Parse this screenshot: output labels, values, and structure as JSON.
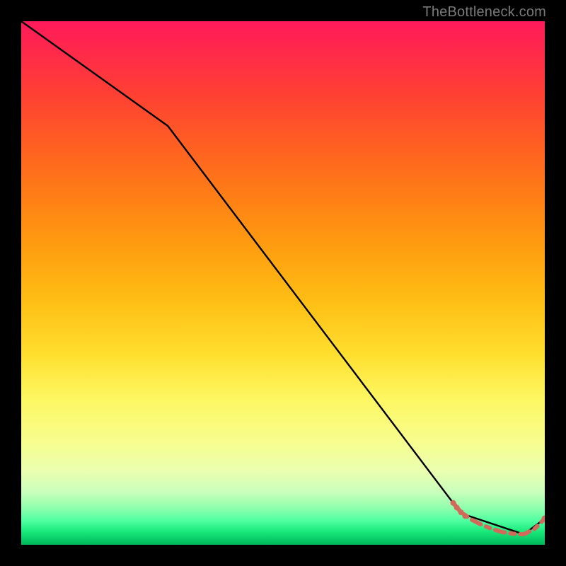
{
  "watermark": "TheBottleneck.com",
  "chart_data": {
    "type": "line",
    "title": "",
    "xlabel": "",
    "ylabel": "",
    "xlim": [
      0,
      100
    ],
    "ylim": [
      0,
      100
    ],
    "grid": false,
    "series": [
      {
        "name": "black-curve",
        "stroke": "#000000",
        "x": [
          0,
          28,
          84,
          96,
          100
        ],
        "values": [
          100,
          80,
          6,
          2,
          5
        ]
      }
    ],
    "dotted_segment": {
      "name": "floor-dashed",
      "stroke": "#d26a5c",
      "stroke_dasharray": "14 8 6 8",
      "x": [
        82.5,
        84,
        86,
        88,
        90,
        92,
        94,
        96,
        98,
        100
      ],
      "values": [
        8.0,
        6.2,
        4.8,
        3.8,
        3.0,
        2.4,
        2.1,
        2.0,
        3.0,
        5.0
      ]
    },
    "segment_markers": {
      "name": "segment-start-markers",
      "stroke": "#d26a5c",
      "x": [
        82.5,
        83.2,
        84.0,
        84.8
      ],
      "values": [
        8.0,
        7.1,
        6.2,
        5.5
      ]
    },
    "end_marker": {
      "name": "end-point",
      "fill": "#d26a5c",
      "x": 100,
      "value": 5.0
    },
    "background_gradient_stops": [
      {
        "pos": 0.0,
        "color": "#ff1a5a"
      },
      {
        "pos": 0.14,
        "color": "#ff4033"
      },
      {
        "pos": 0.34,
        "color": "#ff8015"
      },
      {
        "pos": 0.54,
        "color": "#ffc015"
      },
      {
        "pos": 0.72,
        "color": "#fdf761"
      },
      {
        "pos": 0.86,
        "color": "#eaffb0"
      },
      {
        "pos": 0.93,
        "color": "#8effad"
      },
      {
        "pos": 1.0,
        "color": "#00b85a"
      }
    ]
  }
}
